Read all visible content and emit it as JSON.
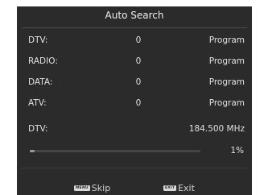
{
  "dialog": {
    "title": "Auto Search"
  },
  "results": [
    {
      "name": "DTV:",
      "count": "0",
      "unit": "Program"
    },
    {
      "name": "RADIO:",
      "count": "0",
      "unit": "Program"
    },
    {
      "name": "DATA:",
      "count": "0",
      "unit": "Program"
    },
    {
      "name": "ATV:",
      "count": "0",
      "unit": "Program"
    }
  ],
  "scan": {
    "type": "DTV:",
    "frequency": "184.500 MHz",
    "progress_label": "1%",
    "progress_fraction": 0.01
  },
  "footer": {
    "skip_key": "MENU",
    "skip_label": "Skip",
    "exit_key": "EXIT",
    "exit_label": "Exit"
  },
  "colors": {
    "panel": "#2b2b2b",
    "text": "#e0e0e0",
    "progress_fill": "#9a9a9a"
  }
}
